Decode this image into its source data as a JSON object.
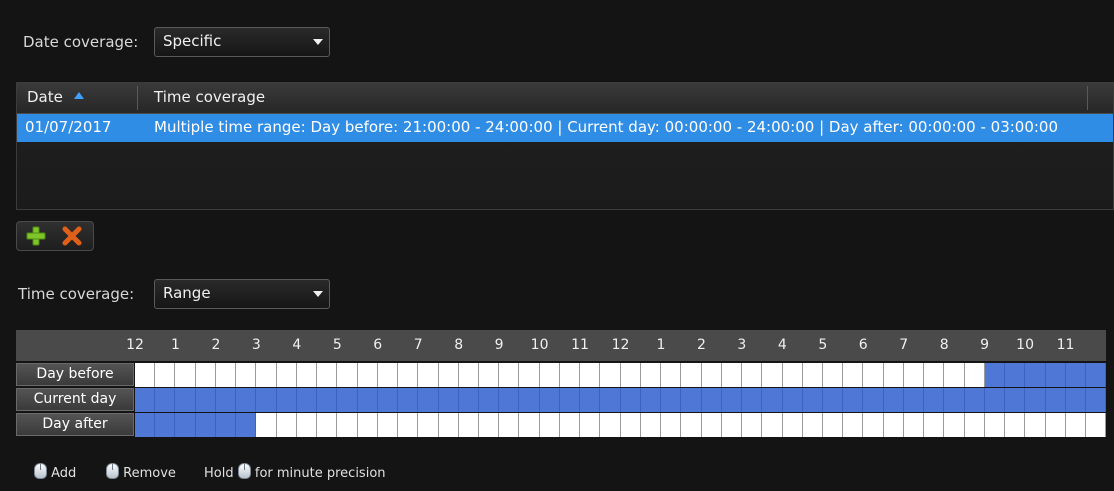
{
  "date_coverage": {
    "label": "Date coverage:",
    "value": "Specific"
  },
  "table": {
    "columns": [
      "Date",
      "Time coverage"
    ],
    "rows": [
      {
        "date": "01/07/2017",
        "time_coverage": "Multiple time range: Day before: 21:00:00 - 24:00:00 | Current day: 00:00:00 - 24:00:00 | Day after: 00:00:00 - 03:00:00",
        "selected": true
      }
    ],
    "sort": {
      "column": "Date",
      "direction": "ascending"
    }
  },
  "actions": {
    "add_icon": "plus-icon",
    "remove_icon": "x-icon"
  },
  "time_coverage": {
    "label": "Time coverage:",
    "value": "Range"
  },
  "schedule": {
    "hour_labels": [
      "12",
      "1",
      "2",
      "3",
      "4",
      "5",
      "6",
      "7",
      "8",
      "9",
      "10",
      "11",
      "12",
      "1",
      "2",
      "3",
      "4",
      "5",
      "6",
      "7",
      "8",
      "9",
      "10",
      "11"
    ],
    "rows": [
      {
        "label": "Day before",
        "active_hours": [
          21,
          24
        ]
      },
      {
        "label": "Current day",
        "active_hours": [
          0,
          24
        ]
      },
      {
        "label": "Day after",
        "active_hours": [
          0,
          3
        ]
      }
    ],
    "colors": {
      "active": "#4f78d6",
      "inactive": "#ffffff"
    }
  },
  "legend": {
    "add": "Add",
    "remove": "Remove",
    "hold_prefix": "Hold",
    "hold_suffix": "for minute precision",
    "icon": "mouse-icon"
  }
}
